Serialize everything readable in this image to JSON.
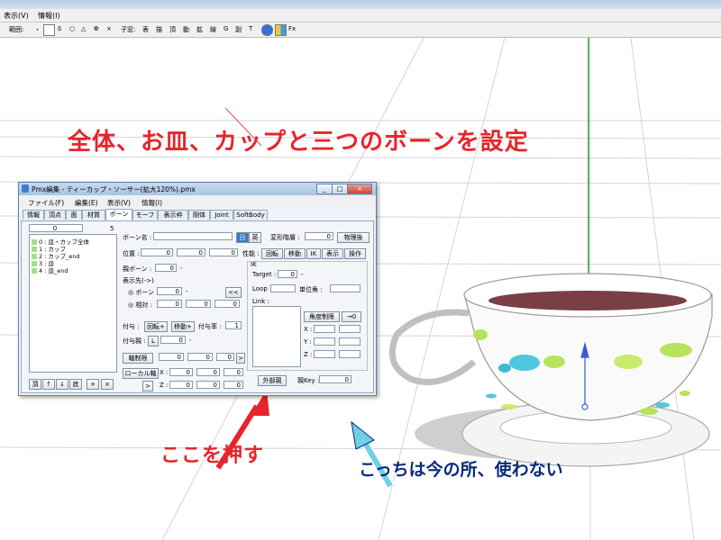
{
  "app": {
    "menu": [
      "表示(V)",
      "情報(I)"
    ],
    "toolbar_label_1": "範囲:",
    "toolbar_symbols": [
      "・",
      "δ",
      "○",
      "△",
      "Φ",
      "×"
    ],
    "toolbar_label_2": "子窓:",
    "toolbar_items": [
      "表",
      "描",
      "頂",
      "動",
      "拡",
      "線",
      "G",
      "副",
      "T"
    ],
    "toolbar_fx": "Fx"
  },
  "annotations": {
    "headline": "全体、お皿、カップと三つのボーンを設定",
    "push_here": "ここを押す",
    "not_used": "こっちは今の所、使わない"
  },
  "pmx": {
    "title": "Pmx編集 - ティーカップ・ソーサー(拡大120%).pmx",
    "window_buttons": [
      "_",
      "□",
      "×"
    ],
    "menu": [
      "ファイル(F)",
      "編集(E)",
      "表示(V)",
      "情報(I)"
    ],
    "tabs": [
      "情報",
      "頂点",
      "面",
      "材質",
      "ボーン",
      "モーフ",
      "表示枠",
      "剛体",
      "Joint",
      "SoftBody"
    ],
    "active_tab": "ボーン",
    "list_count": "0",
    "list_count_right": "5",
    "bones": [
      "0 : 皿・カップ全体",
      "1 : カップ",
      "2 : カップ_end",
      "3 : 皿",
      "4 : 皿_end"
    ],
    "list_buttons": [
      "頂",
      "↑",
      "↓",
      "底",
      "+",
      "×"
    ],
    "bone_name_label": "ボーン名 :",
    "bone_name_value": "",
    "jp_btn": "日",
    "en_btn": "英",
    "deform_label": "変形階層 :",
    "deform_value": "0",
    "after_physics": "物理後",
    "pos_label": "位置 :",
    "pos_values": [
      "0",
      "0",
      "0"
    ],
    "perf_label": "性能 :",
    "perf_buttons": [
      "回転",
      "移動",
      "IK",
      "表示",
      "操作"
    ],
    "parent_label": "親ボーン :",
    "parent_value": "0",
    "parent_dash": "-",
    "display_dest_label": "表示先(->)",
    "bone_radio": "ボーン :",
    "bone_radio_value": "0",
    "relative_radio": "相対 :",
    "relative_values": [
      "0",
      "0",
      "0"
    ],
    "arrow_btn": "<<",
    "grant_label": "付与 :",
    "grant_rot": "回転+",
    "grant_move": "移動+",
    "grant_rate_label": "付与率 :",
    "grant_rate_value": "1",
    "grant_parent_label": "付与親 :",
    "grant_parent_btn": "L",
    "grant_parent_value": "0",
    "axis_limit_btn": "軸制限",
    "axis_values": [
      "0",
      "0",
      "0"
    ],
    "axis_arrow": ">",
    "local_axis_btn": "ローカル軸",
    "x_label": "X :",
    "z_label": "Z :",
    "local_x_values": [
      "0",
      "0",
      "0"
    ],
    "local_z_values": [
      "0",
      "0",
      "0"
    ],
    "local_arrow": ">",
    "ik_label": "IK",
    "target_label": "Target :",
    "target_value": "0",
    "loop_label": "Loop :",
    "unit_angle_label": "単位角 :",
    "link_label": "Link :",
    "angle_limit_btn": "角度制限",
    "angle_arrow_btn": "→0",
    "ik_x": "X :",
    "ik_y": "Y :",
    "ik_z": "Z :",
    "external_parent_btn": "外部親",
    "key_label": "親Key :",
    "key_value": "0"
  }
}
